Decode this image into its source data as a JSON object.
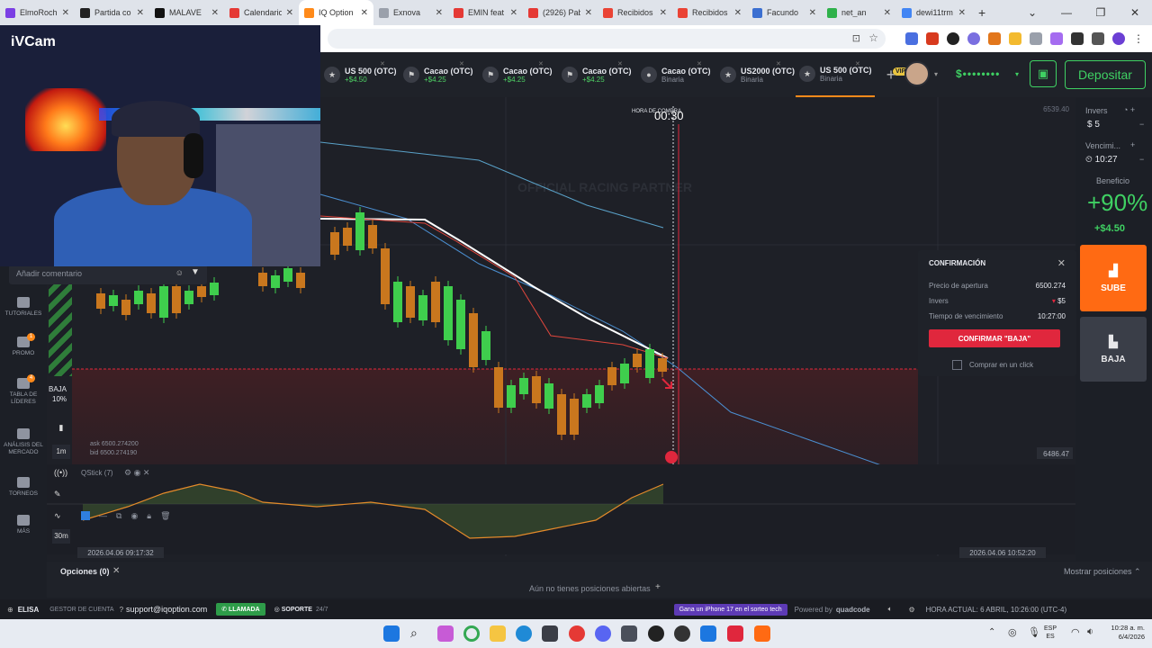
{
  "browser": {
    "tabs": [
      {
        "label": "ElmoRoch",
        "color": "#7b3fe4"
      },
      {
        "label": "Partida co",
        "color": "#222222"
      },
      {
        "label": "MALAVE",
        "color": "#111111"
      },
      {
        "label": "Calendario",
        "color": "#e53935"
      },
      {
        "label": "IQ Option",
        "color": "#ff8a1a",
        "active": true
      },
      {
        "label": "Exnova",
        "color": "#9aa0ab"
      },
      {
        "label": "EMIN feat",
        "color": "#e53935"
      },
      {
        "label": "(2926) Pab",
        "color": "#e53935"
      },
      {
        "label": "Recibidos",
        "color": "#ea4335"
      },
      {
        "label": "Recibidos",
        "color": "#ea4335"
      },
      {
        "label": "Facundo",
        "color": "#3b6fd1"
      },
      {
        "label": "net_an",
        "color": "#2fb14b"
      },
      {
        "label": "dewi11trm",
        "color": "#4285f4"
      }
    ],
    "new_tab": "+",
    "window_controls": [
      "⌄",
      "—",
      "❐",
      "✕"
    ]
  },
  "webcam": {
    "title": "iVCam"
  },
  "comment": {
    "placeholder": "Añadir comentario"
  },
  "assets": [
    {
      "name": "US 500 (OTC)",
      "sub": "+$4.50",
      "icon": "flag-us-icon",
      "sub_green": true
    },
    {
      "name": "Cacao (OTC)",
      "sub": "+$4.25",
      "icon": "flag-icon",
      "sub_green": true
    },
    {
      "name": "Cacao (OTC)",
      "sub": "+$4.25",
      "icon": "flag-icon",
      "sub_green": true
    },
    {
      "name": "Cacao (OTC)",
      "sub": "+$4.25",
      "icon": "flag-icon",
      "sub_green": true
    },
    {
      "name": "Cacao (OTC)",
      "sub": "Binaria",
      "icon": "cocoa-icon",
      "sub_green": false
    },
    {
      "name": "US2000 (OTC)",
      "sub": "Binaria",
      "icon": "flag-us-icon",
      "sub_green": false
    },
    {
      "name": "US 500 (OTC)",
      "sub": "Binaria",
      "icon": "flag-us-icon",
      "sub_green": false,
      "active": true
    }
  ],
  "header": {
    "vip": "VIP",
    "balance": "$••••••••",
    "deposit": "Depositar"
  },
  "nav": [
    {
      "label": "TUTORIALES",
      "badge": ""
    },
    {
      "label": "PROMO",
      "badge": "1"
    },
    {
      "label": "TABLA DE LÍDERES",
      "badge": "4"
    },
    {
      "label": "ANÁLISIS DEL MERCADO",
      "badge": ""
    },
    {
      "label": "TORNEOS",
      "badge": ""
    },
    {
      "label": "MÁS",
      "badge": ""
    }
  ],
  "chart_tools": {
    "baja_label": "BAJA",
    "baja_pct": "10%",
    "timeframe": "1m",
    "period": "30m",
    "ask": "ask 6500.274200",
    "bid": "bid 6500.274190",
    "indicator": "QStick (7)",
    "purchase_time_label": "HORA DE COMPRA",
    "purchase_time": "00:30",
    "price_top": "6539.40",
    "price_low": "6486.47",
    "time_left": "2026.04.06 09:17:32",
    "time_right": "2026.04.06 10:52:20",
    "watermark": "OFFICIAL RACING PARTNER"
  },
  "right_panel": {
    "invest_label": "Invers",
    "invest_value": "$ 5",
    "expiry_label": "Vencimi...",
    "expiry_value": "10:27",
    "profit_label": "Beneficio",
    "profit_pct": "+90%",
    "profit_amount": "+$4.50",
    "up_label": "SUBE",
    "down_label": "BAJA"
  },
  "confirm": {
    "title": "CONFIRMACIÓN",
    "open_price_label": "Precio de apertura",
    "open_price": "6500.274",
    "invest_label": "Invers",
    "invest_value": "$5",
    "expiry_label": "Tiempo de vencimiento",
    "expiry_value": "10:27:00",
    "button": "CONFIRMAR \"BAJA\"",
    "one_click": "Comprar en un click"
  },
  "positions": {
    "tab": "Opciones (0)",
    "empty": "Aún no tienes posiciones abiertas",
    "show": "Mostrar posiciones"
  },
  "status": {
    "user": "ELISA",
    "account_manager": "GESTOR DE CUENTA",
    "email": "support@iqoption.com",
    "call": "LLAMADA",
    "support": "SOPORTE",
    "support_hours": "24/7",
    "promo": "Gana un iPhone 17 en el sorteo tech",
    "powered": "Powered by",
    "powered_brand": "quadcode",
    "clock": "HORA ACTUAL: 6 ABRIL, 10:26:00 (UTC-4)"
  },
  "taskbar": {
    "lang": "ESP",
    "lang2": "ES",
    "time": "10:28 a. m.",
    "date": "6/4/2026"
  }
}
